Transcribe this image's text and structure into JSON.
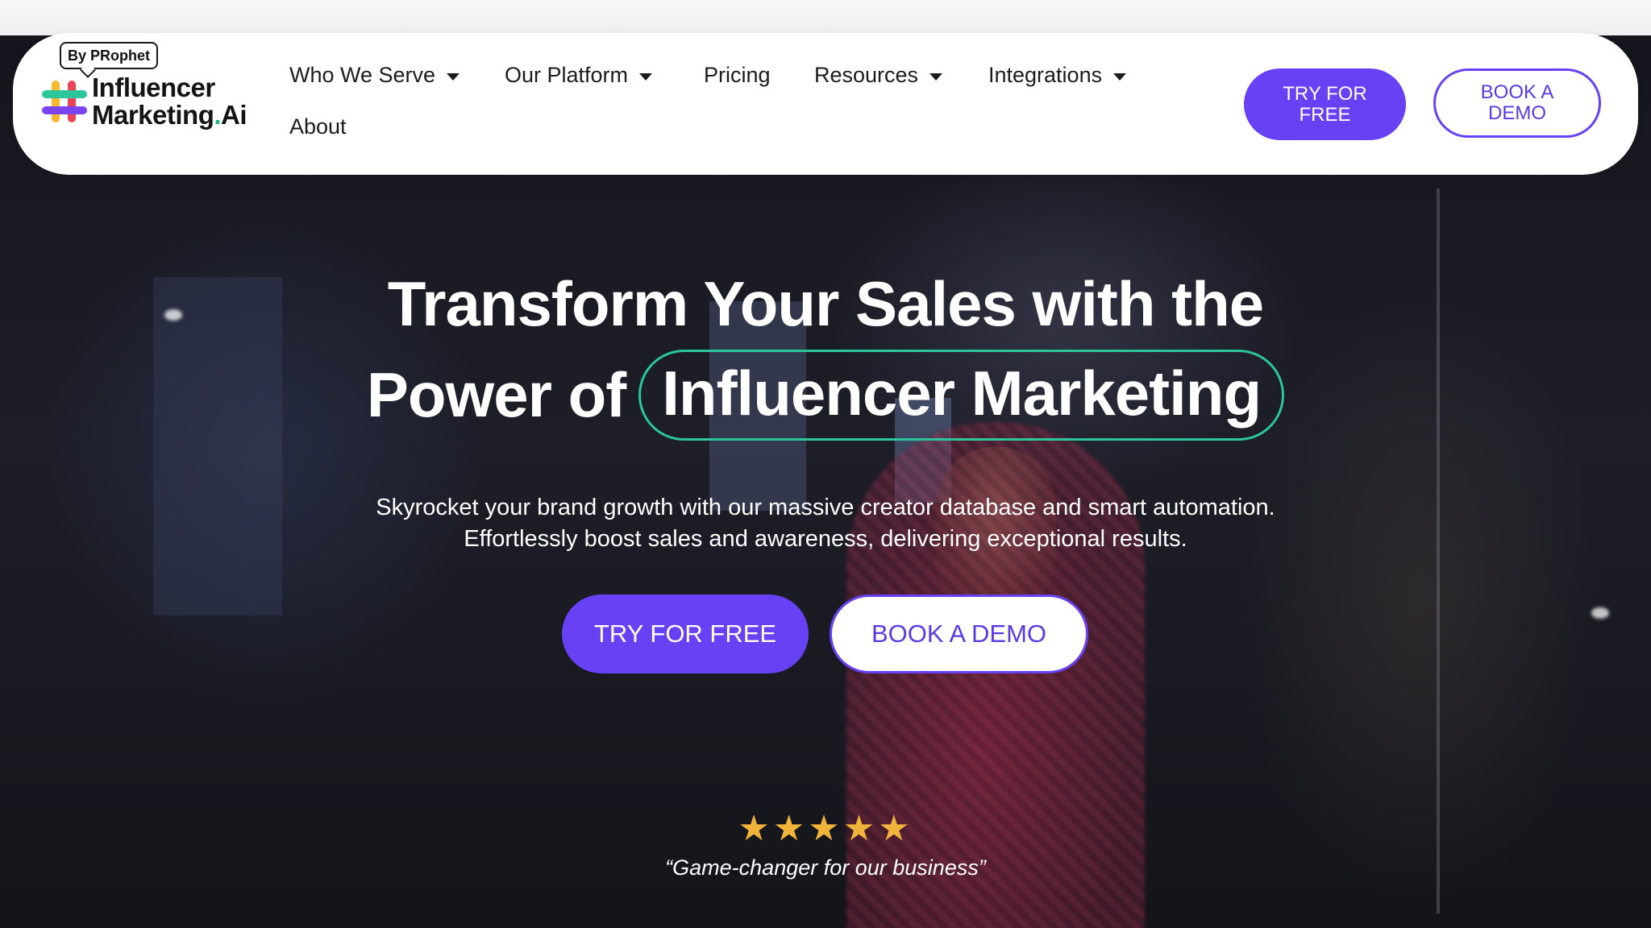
{
  "brand": {
    "tag": "By PRophet",
    "name_line1": "Influencer",
    "name_line2": "Marketing",
    "name_dot": ".",
    "name_suffix": "Ai",
    "colors": {
      "purple": "#6841f5",
      "green": "#2bc69a",
      "star": "#f1b43b"
    }
  },
  "nav": {
    "items": [
      {
        "label": "Who We Serve",
        "has_caret": true
      },
      {
        "label": "Our Platform",
        "has_caret": true
      },
      {
        "label": "Pricing",
        "has_caret": false
      },
      {
        "label": "Resources",
        "has_caret": true
      },
      {
        "label": "Integrations",
        "has_caret": true
      },
      {
        "label": "About",
        "has_caret": false
      }
    ],
    "cta_primary_line1": "TRY FOR",
    "cta_primary_line2": "FREE",
    "cta_secondary_line1": "BOOK A",
    "cta_secondary_line2": "DEMO"
  },
  "hero": {
    "headline_line1": "Transform Your Sales with the",
    "headline_line2_prefix": "Power of",
    "headline_highlight": "Influencer Marketing",
    "subtext_line1": "Skyrocket your brand growth with our massive creator database and smart automation.",
    "subtext_line2": "Effortlessly boost sales and awareness, delivering exceptional results.",
    "cta_primary": "TRY FOR FREE",
    "cta_secondary": "BOOK A DEMO",
    "rating_stars": 5,
    "stars_display": "★★★★★",
    "testimonial": "“Game-changer for our business”"
  }
}
